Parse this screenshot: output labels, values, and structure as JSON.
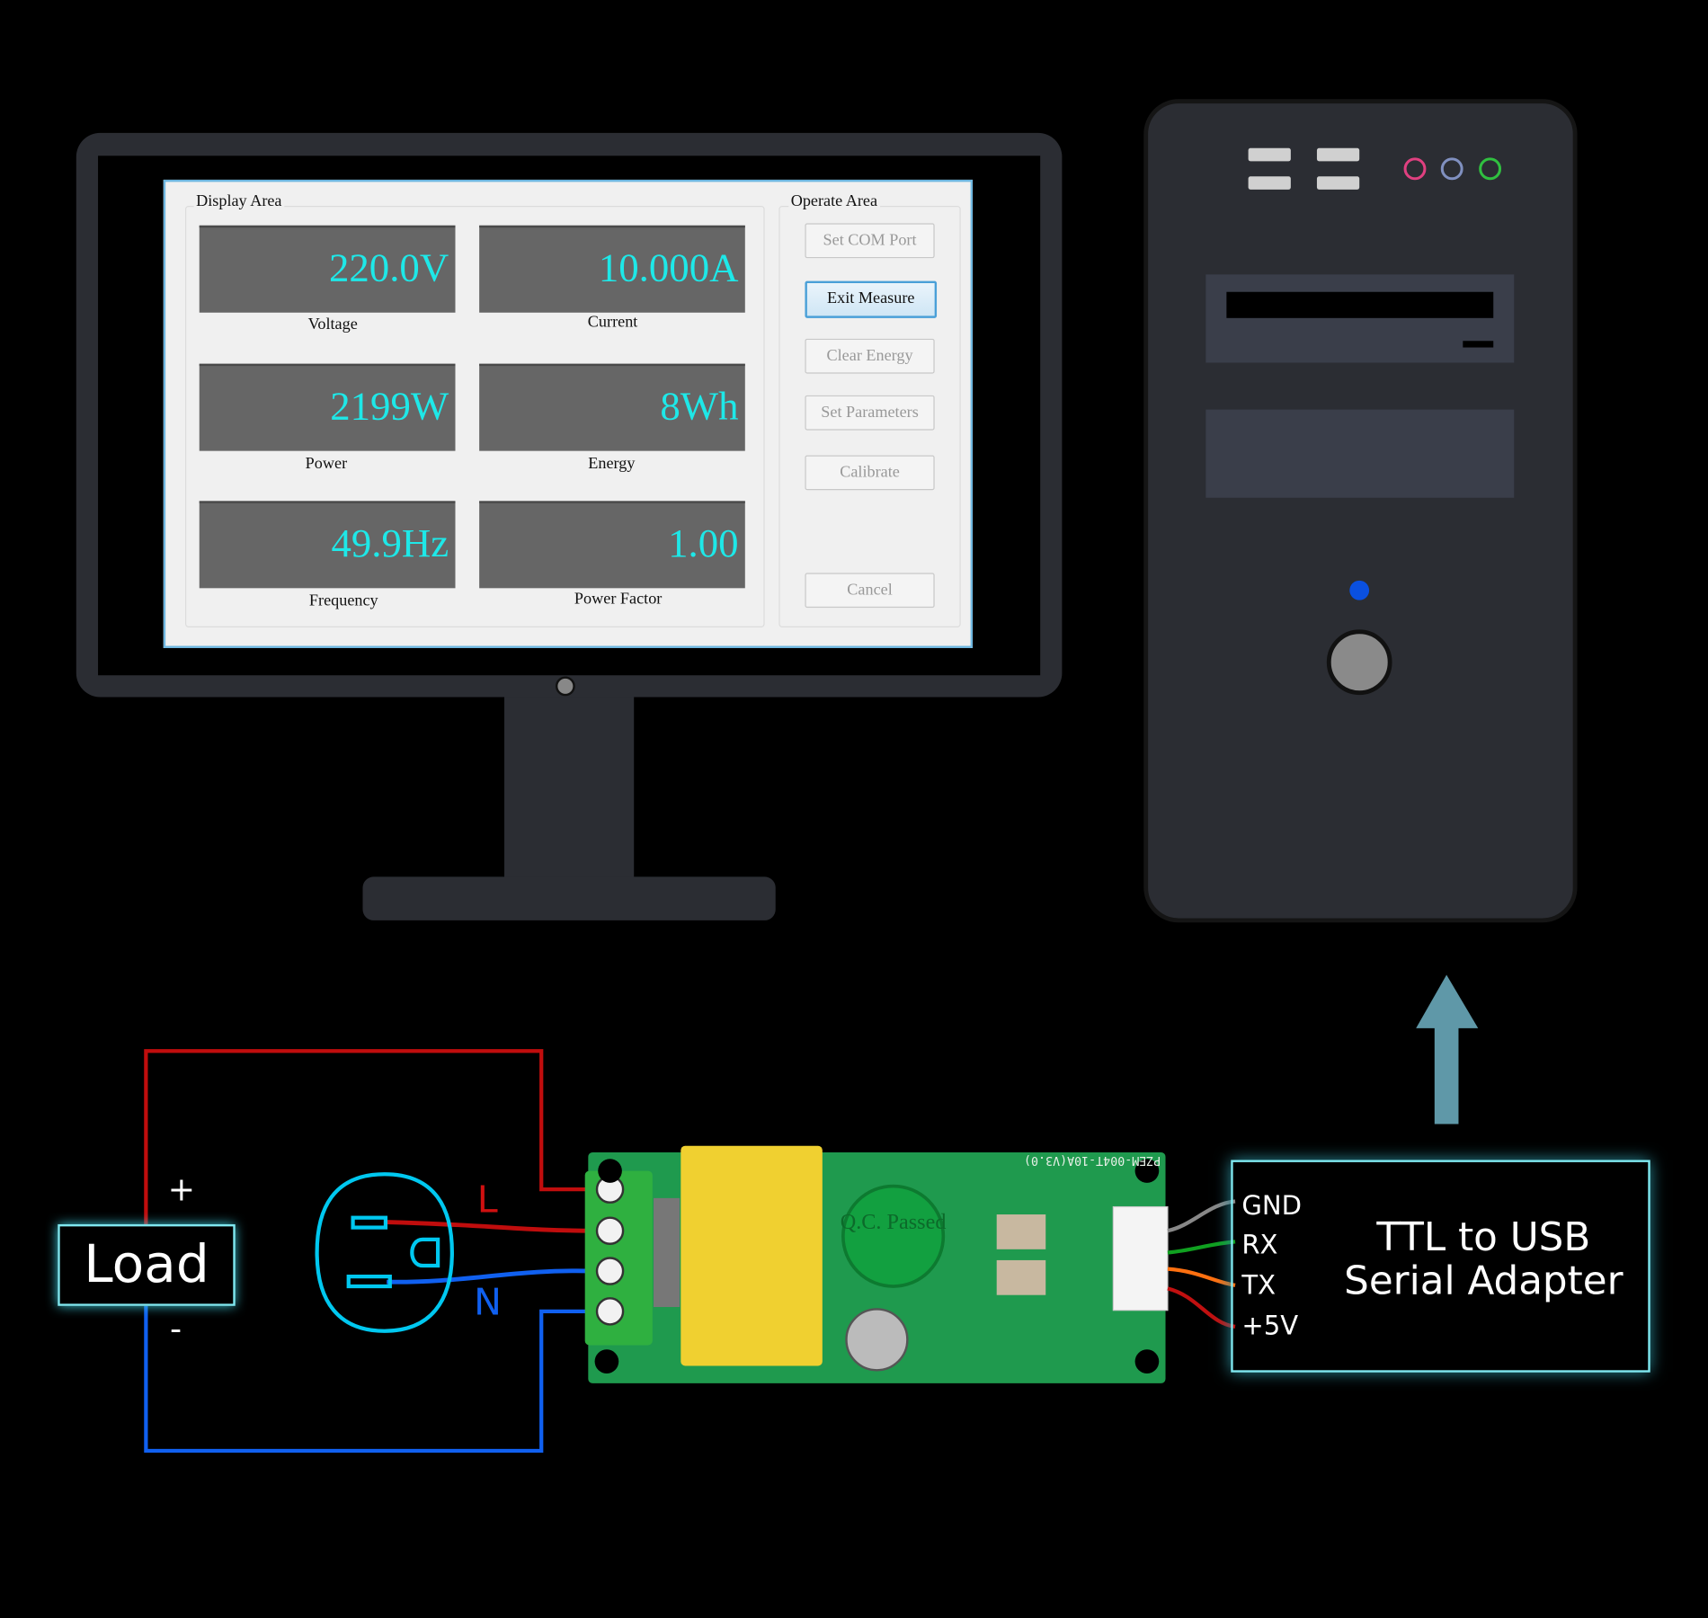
{
  "software": {
    "display_area_label": "Display Area",
    "operate_area_label": "Operate Area",
    "readings": [
      {
        "value": "220.0V",
        "label": "Voltage"
      },
      {
        "value": "10.000A",
        "label": "Current"
      },
      {
        "value": "2199W",
        "label": "Power"
      },
      {
        "value": "8Wh",
        "label": "Energy"
      },
      {
        "value": "49.9Hz",
        "label": "Frequency"
      },
      {
        "value": "1.00",
        "label": "Power Factor"
      }
    ],
    "buttons": [
      {
        "label": "Set COM Port",
        "enabled": false
      },
      {
        "label": "Exit Measure",
        "enabled": true
      },
      {
        "label": "Clear Energy",
        "enabled": false
      },
      {
        "label": "Set Parameters",
        "enabled": false
      },
      {
        "label": "Calibrate",
        "enabled": false
      },
      {
        "label": "Cancel",
        "enabled": false
      }
    ],
    "value_color": "#1ee8e8"
  },
  "circuit": {
    "load_label": "Load",
    "plus": "+",
    "minus": "-",
    "live_label": "L",
    "neutral_label": "N",
    "live_color": "#d01010",
    "neutral_color": "#1060f0",
    "module_marking": "PZEM-004T-10A(V3.0)",
    "qc_stamp": "Q.C. Passed"
  },
  "adapter": {
    "pins": [
      "GND",
      "RX",
      "TX",
      "+5V"
    ],
    "pin_wire_colors": [
      "#888888",
      "#10a020",
      "#ff7010",
      "#c01010"
    ],
    "title_line1": "TTL to USB",
    "title_line2": "Serial Adapter",
    "arrow_color": "#5f98a8"
  }
}
